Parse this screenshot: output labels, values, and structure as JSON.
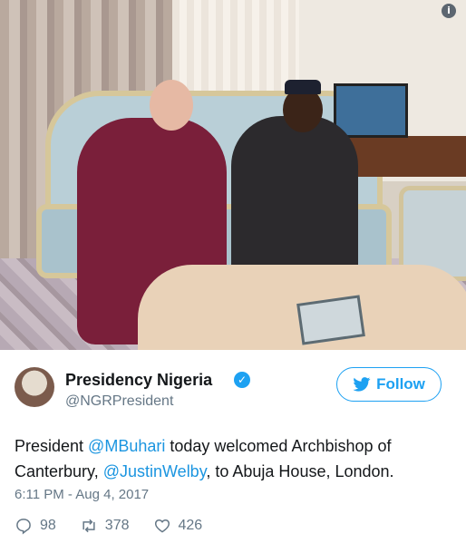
{
  "tweet": {
    "display_name": "Presidency Nigeria",
    "handle": "@NGRPresident",
    "follow_label": "Follow",
    "text_prefix": "President ",
    "mention1": "@MBuhari",
    "text_middle": " today welcomed Archbishop of Canterbury, ",
    "mention2": "@JustinWelby",
    "text_suffix": ", to Abuja House, London.",
    "timestamp": "6:11 PM - Aug 4, 2017",
    "replies": "98",
    "retweets": "378",
    "likes": "426"
  },
  "icons": {
    "info": "info-icon",
    "verified": "verified-badge-icon",
    "bird": "twitter-bird-icon",
    "reply": "reply-icon",
    "retweet": "retweet-icon",
    "like": "heart-icon"
  },
  "colors": {
    "accent": "#1da1f2",
    "mention": "#1b95e0",
    "muted": "#657786",
    "text": "#14171a"
  }
}
